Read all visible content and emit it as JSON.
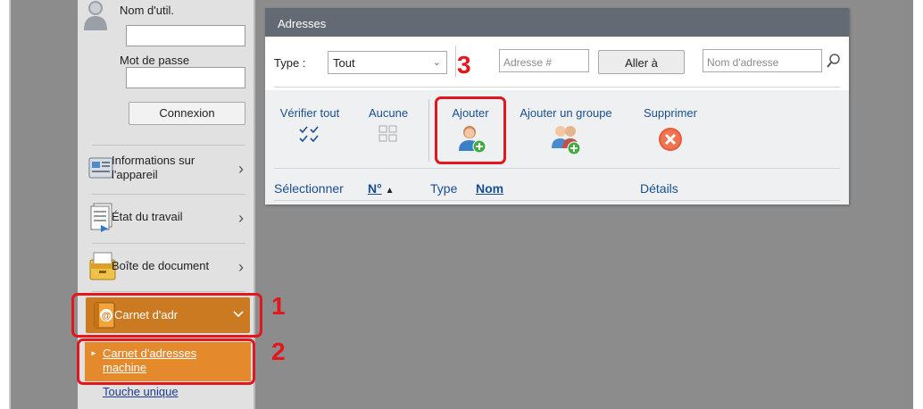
{
  "sidebar": {
    "username_label": "Nom d'util.",
    "password_label": "Mot de passe",
    "login_button": "Connexion",
    "items": [
      {
        "label_line1": "Informations sur",
        "label_line2": "l'appareil"
      },
      {
        "label": "État du travail"
      },
      {
        "label": "Boîte de document"
      }
    ],
    "carnet": {
      "label": "Carnet d'adr"
    },
    "sub_active": {
      "label_line1": "Carnet d'adresses",
      "label_line2": "machine"
    },
    "touche": "Touche unique"
  },
  "steps": {
    "one": "1",
    "two": "2",
    "three": "3"
  },
  "panel": {
    "title": "Adresses",
    "type_label": "Type :",
    "type_value": "Tout",
    "address_placeholder": "Adresse #",
    "goto_button": "Aller à",
    "name_placeholder": "Nom d'adresse",
    "toolbar": {
      "check_all": "Vérifier tout",
      "none": "Aucune",
      "add": "Ajouter",
      "add_group": "Ajouter un groupe",
      "delete": "Supprimer"
    },
    "columns": {
      "select": "Sélectionner",
      "number": "N°",
      "type": "Type",
      "name": "Nom",
      "details": "Détails"
    }
  },
  "colors": {
    "accent": "#e48a2c",
    "highlight": "#e3151d",
    "header": "#636a73",
    "link": "#1a4f8f"
  }
}
